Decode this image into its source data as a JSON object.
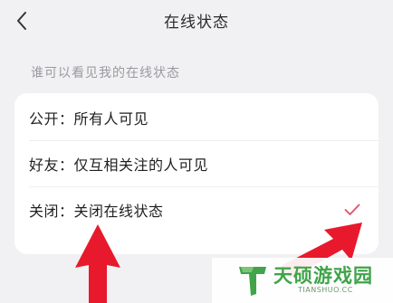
{
  "header": {
    "title": "在线状态",
    "back_icon": "chevron-left-icon"
  },
  "section": {
    "label": "谁可以看见我的在线状态"
  },
  "options": [
    {
      "label": "公开：所有人可见",
      "selected": false
    },
    {
      "label": "好友：仅互相关注的人可见",
      "selected": false
    },
    {
      "label": "关闭：关闭在线状态",
      "selected": true
    }
  ],
  "check_icon": "checkmark-icon",
  "accent_color": "#e0506a",
  "annotation_color": "#e8192c",
  "watermark": {
    "name": "天硕游戏园",
    "url": "TIANSHUO.CC",
    "brand_color": "#3fa44a"
  }
}
